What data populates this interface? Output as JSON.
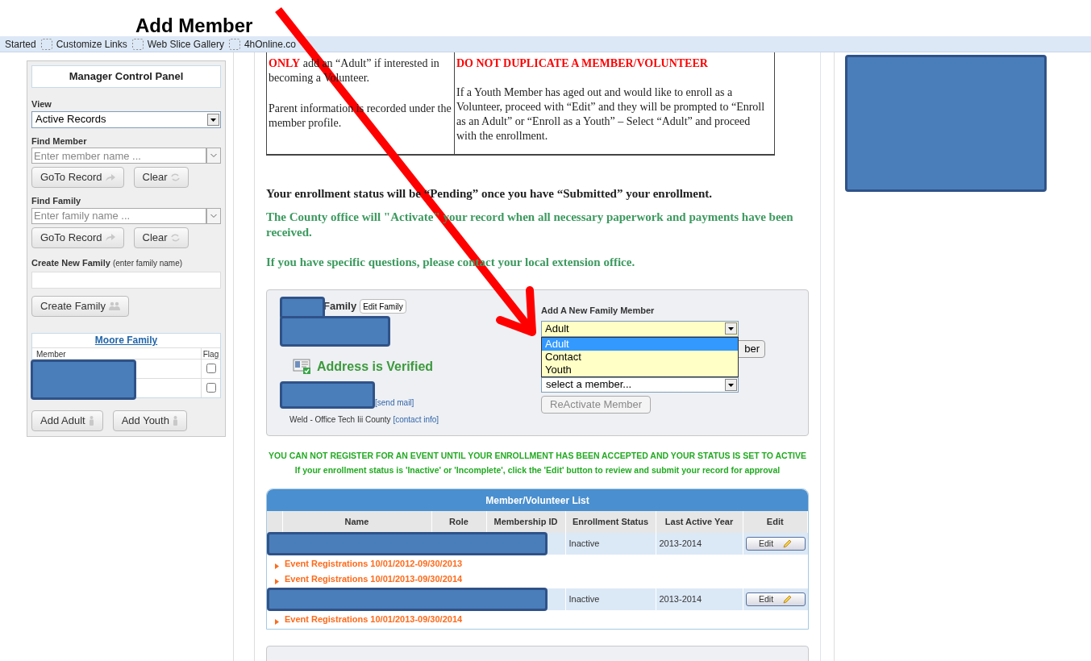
{
  "annotation": {
    "title": "Add Member"
  },
  "bookmarks": [
    "Started",
    "Customize Links",
    "Web Slice Gallery",
    "4hOnline.co"
  ],
  "sidebar": {
    "title": "Manager Control Panel",
    "view": {
      "label": "View",
      "value": "Active Records"
    },
    "find_member": {
      "label": "Find Member",
      "placeholder": "Enter member name ...",
      "goto": "GoTo Record",
      "clear": "Clear"
    },
    "find_family": {
      "label": "Find Family",
      "placeholder": "Enter family name ...",
      "goto": "GoTo Record",
      "clear": "Clear"
    },
    "create_family": {
      "label": "Create New Family",
      "hint": "(enter family name)",
      "button": "Create Family"
    },
    "family_table": {
      "title": "Moore Family",
      "columns": [
        "Member",
        "Flag"
      ],
      "rows": [
        {
          "flagged": false
        },
        {
          "flagged": false
        }
      ]
    },
    "buttons": [
      "Add Adult",
      "Add Youth"
    ]
  },
  "instructions": {
    "left": [
      {
        "kind": "lead",
        "strong": "ONLY",
        "text": " add an “Adult” if interested in becoming a Volunteer."
      },
      {
        "kind": "plain",
        "text": "Parent information is recorded under the member profile."
      }
    ],
    "right": [
      {
        "kind": "warning",
        "text": "DO NOT DUPLICATE A MEMBER/VOLUNTEER"
      },
      {
        "kind": "plain",
        "text": "If a Youth Member has aged out and would like to enroll as a Volunteer, proceed with “Edit” and they will be prompted to “Enroll as an Adult” or “Enroll as a Youth” – Select “Adult” and proceed with the enrollment."
      }
    ]
  },
  "notices": [
    {
      "kind": "dark",
      "text": "Your enrollment status will be “Pending” once you have “Submitted” your enrollment."
    },
    {
      "kind": "green",
      "text": "The County office will \"Activate\" your record when all necessary paperwork and payments have been received."
    },
    {
      "kind": "green",
      "text": "If you have specific questions, please contact your local extension office."
    }
  ],
  "family": {
    "label": "Family",
    "edit_button": "Edit Family",
    "verified": "Address is Verified",
    "send_mail": "[send mail]",
    "county": "Weld - Office Tech Iii County",
    "contact": "[contact info]",
    "add_member": {
      "label": "Add A New Family Member",
      "value": "Adult",
      "options": [
        {
          "label": "Adult",
          "selected": true
        },
        {
          "label": "Contact",
          "selected": false
        },
        {
          "label": "Youth",
          "selected": false
        }
      ],
      "hidden_button": "ber",
      "member_select": "select a member...",
      "reactivate": "ReActivate Member"
    }
  },
  "alerts": [
    "YOU CAN NOT REGISTER FOR AN EVENT UNTIL YOUR ENROLLMENT HAS BEEN ACCEPTED AND YOUR STATUS IS SET TO ACTIVE",
    "If your enrollment status is 'Inactive' or 'Incomplete', click the 'Edit' button to review and submit your record for approval"
  ],
  "member_list": {
    "title": "Member/Volunteer List",
    "columns": [
      "Name",
      "Role",
      "Membership ID",
      "Enrollment Status",
      "Last Active Year",
      "Edit"
    ],
    "rows": [
      {
        "status": "Inactive",
        "year": "2013-2014",
        "edit": "Edit",
        "events": [
          "Event Registrations 10/01/2012-09/30/2013",
          "Event Registrations 10/01/2013-09/30/2014"
        ]
      },
      {
        "status": "Inactive",
        "year": "2013-2014",
        "edit": "Edit",
        "events": [
          "Event Registrations 10/01/2013-09/30/2014"
        ]
      }
    ]
  }
}
